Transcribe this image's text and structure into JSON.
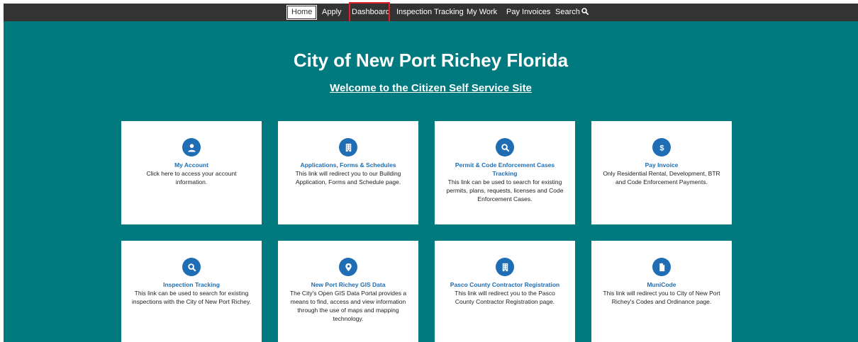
{
  "nav": {
    "items": [
      "Home",
      "Apply",
      "Dashboard",
      "Inspection Tracking",
      "My Work",
      "Pay Invoices",
      "Search"
    ]
  },
  "header": {
    "title": "City of New Port Richey Florida",
    "subtitle": "Welcome to the Citizen Self Service Site"
  },
  "cards": [
    {
      "icon": "user-icon",
      "title": "My Account",
      "desc": "Click here to access your account information."
    },
    {
      "icon": "building-icon",
      "title": "Applications, Forms & Schedules",
      "desc": "This link will redirect you to our Building Application, Forms and Schedule page."
    },
    {
      "icon": "search-icon",
      "title": "Permit & Code Enforcement Cases Tracking",
      "desc": "This link can be used to search for existing permits, plans, requests, licenses and Code Enforcement Cases."
    },
    {
      "icon": "dollar-icon",
      "title": "Pay Invoice",
      "desc": "Only Residential Rental, Development, BTR and Code Enforcement Payments."
    },
    {
      "icon": "search-icon",
      "title": "Inspection Tracking",
      "desc": "This link can be used to search for existing inspections with the City of New Port Richey."
    },
    {
      "icon": "map-marker-icon",
      "title": "New Port Richey GIS Data",
      "desc": "The City's Open GIS Data Portal provides a means to find, access and view information through the use of maps and mapping technology."
    },
    {
      "icon": "building-icon",
      "title": "Pasco County Contractor Registration",
      "desc": "This link will redirect you to the Pasco County Contractor Registration page."
    },
    {
      "icon": "file-icon",
      "title": "MuniCode",
      "desc": "This link will redirect you to City of New Port Richey's Codes and Ordinance page."
    }
  ],
  "colors": {
    "topbar": "#333333",
    "background": "#00797f",
    "accent": "#1f6db4",
    "highlight": "#e01f26"
  }
}
